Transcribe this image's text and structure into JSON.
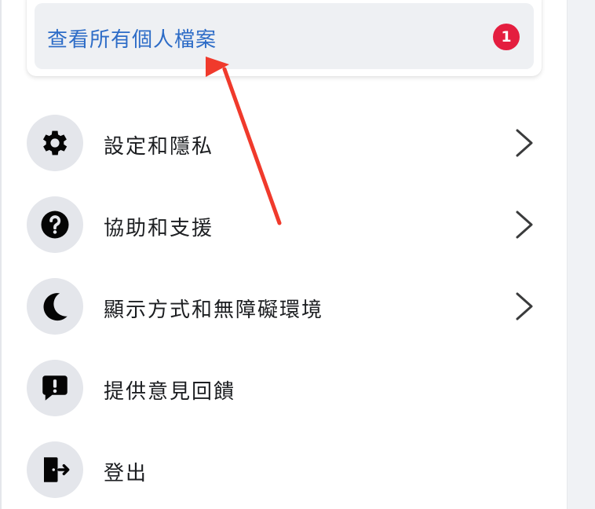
{
  "profile_card": {
    "view_all_label": "查看所有個人檔案",
    "badge_count": "1"
  },
  "menu": {
    "items": [
      {
        "label": "設定和隱私",
        "icon": "gear-icon",
        "has_chevron": true
      },
      {
        "label": "協助和支援",
        "icon": "question-circle-icon",
        "has_chevron": true
      },
      {
        "label": "顯示方式和無障礙環境",
        "icon": "moon-icon",
        "has_chevron": true
      },
      {
        "label": "提供意見回饋",
        "icon": "feedback-icon",
        "has_chevron": false
      },
      {
        "label": "登出",
        "icon": "logout-icon",
        "has_chevron": false
      }
    ]
  },
  "colors": {
    "link_blue": "#2d6cc7",
    "badge_red": "#e41e3f",
    "annotation_arrow": "#f03a2c",
    "icon_bg": "#e4e6eb"
  }
}
